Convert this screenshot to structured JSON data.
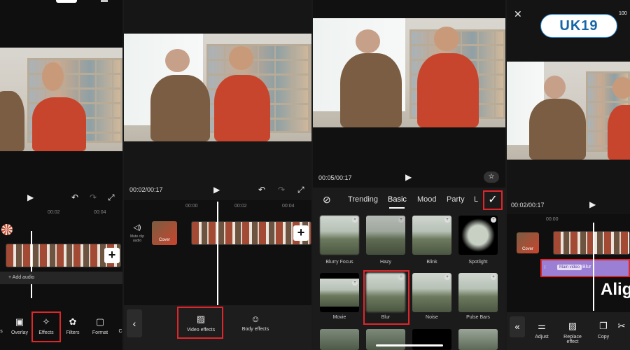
{
  "panel1": {
    "tick_label": "00:02",
    "tick_label2": "00:04",
    "add_audio": "+ Add audio",
    "toolbar": [
      {
        "label": "s"
      },
      {
        "label": "Overlay",
        "icon": "▣"
      },
      {
        "label": "Effects",
        "icon": "✧"
      },
      {
        "label": "Filters",
        "icon": "✿"
      },
      {
        "label": "Format",
        "icon": "▢"
      },
      {
        "label": "C"
      }
    ]
  },
  "panel2": {
    "time": "00:02/00:17",
    "ticks": [
      "00:00",
      "00:02",
      "00:04"
    ],
    "mute_label": "Mute clip audio",
    "cover_label": "Cover",
    "toolbar": [
      {
        "label": "Video effects",
        "icon": "▨"
      },
      {
        "label": "Body effects",
        "icon": "☺"
      }
    ]
  },
  "panel3": {
    "time": "00:05/00:17",
    "tabs": [
      "Trending",
      "Basic",
      "Mood",
      "Party",
      "L"
    ],
    "effects": [
      {
        "label": "Blurry Focus"
      },
      {
        "label": "Hazy"
      },
      {
        "label": "Blink"
      },
      {
        "label": "Spotlight"
      },
      {
        "label": "Movie"
      },
      {
        "label": "Blur"
      },
      {
        "label": "Noise"
      },
      {
        "label": "Pulse Bars"
      }
    ]
  },
  "panel4": {
    "top_num": "100",
    "logo": "UK19",
    "time": "00:02/00:17",
    "tick": "00:00",
    "cover_label": "Cover",
    "main_video": "Main video",
    "effect_name": "Blur",
    "big_text": "Align",
    "toolbar": [
      {
        "label": "Adjust",
        "icon": "⚌"
      },
      {
        "label": "Replace effect",
        "icon": "▨"
      },
      {
        "label": "Copy",
        "icon": "❐"
      },
      {
        "label": "",
        "icon": "✂"
      }
    ]
  },
  "colors": {
    "highlight": "#e0262b",
    "effect_track": "#9b7fd4",
    "bg": "#0f0f0f"
  }
}
